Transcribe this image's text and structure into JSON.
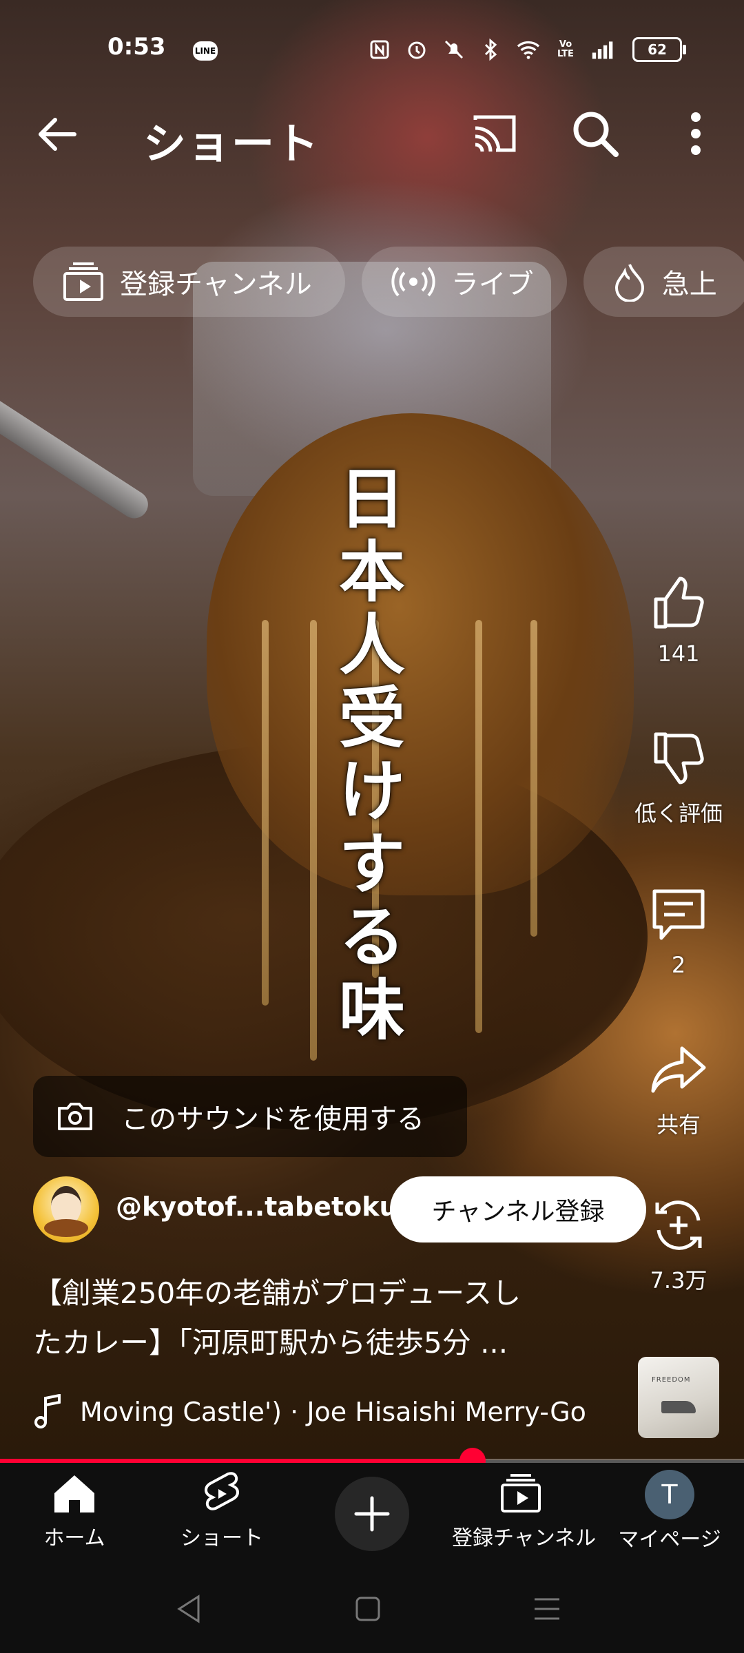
{
  "status_bar": {
    "time": "0:53",
    "notification_badge": "LINE",
    "battery": "62",
    "icons": [
      "nfc-icon",
      "alarm-icon",
      "mute-icon",
      "bluetooth-icon",
      "wifi-icon",
      "volte-icon",
      "signal-icon",
      "battery-icon"
    ]
  },
  "header": {
    "title": "ショート",
    "icons": [
      "back-arrow-icon",
      "cast-icon",
      "search-icon",
      "more-vert-icon"
    ]
  },
  "chips": [
    {
      "label": "登録チャンネル",
      "icon": "subscriptions-icon"
    },
    {
      "label": "ライブ",
      "icon": "live-icon"
    },
    {
      "label": "急上",
      "icon": "trending-icon"
    }
  ],
  "video": {
    "overlay_caption": "日本人受けする味"
  },
  "actions": {
    "like_count": "141",
    "dislike_label": "低く評価",
    "comment_count": "2",
    "share_label": "共有",
    "remix_count": "7.3万"
  },
  "sound": {
    "use_sound_label": "このサウンドを使用する"
  },
  "channel": {
    "handle": "@kyotof...tabetoku",
    "subscribe_label": "チャンネル登録"
  },
  "description": {
    "line1": "【創業250年の老舗がプロデュースし",
    "line2": "たカレー】「河原町駅から徒歩5分 ..."
  },
  "music": {
    "track_text": "Moving Castle') · Joe Hisaishi     Merry-Go",
    "album_text": "FREEDOM"
  },
  "playback": {
    "progress_fraction": 0.635
  },
  "bottom_nav": {
    "home": "ホーム",
    "shorts": "ショート",
    "subscriptions": "登録チャンネル",
    "mypage": "マイページ",
    "avatar_letter": "T"
  },
  "colors": {
    "accent": "#ff0033",
    "nav_bg": "#0f0f0f",
    "chip_bg": "rgba(255,255,255,0.16)"
  }
}
